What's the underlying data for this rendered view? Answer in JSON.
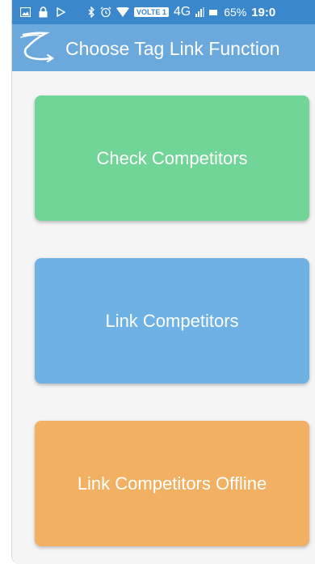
{
  "status_bar": {
    "network": "4G",
    "volte": "VOLTE 1",
    "battery": "65%",
    "time": "19:0",
    "icons": [
      "image-icon",
      "lock-icon",
      "play-icon",
      "bluetooth-icon",
      "alarm-icon",
      "wifi-icon",
      "signal-icon",
      "battery-icon"
    ]
  },
  "app_bar": {
    "title": "Choose Tag Link Function",
    "logo": "app-logo-icon"
  },
  "buttons": [
    {
      "label": "Check Competitors",
      "color": "#70d596"
    },
    {
      "label": "Link Competitors",
      "color": "#6db1e5"
    },
    {
      "label": "Link Competitors Offline",
      "color": "#f2b062"
    }
  ],
  "colors": {
    "status_bar": "#3a87cc",
    "app_bar": "#6ba8dc",
    "background": "#f5f5f5"
  }
}
